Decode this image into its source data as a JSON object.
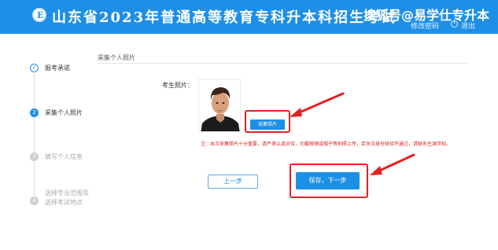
{
  "header": {
    "logo_char": "E",
    "title": "山东省2023年普通高等教育专科升本科招生考试",
    "watermark": "搜狐号@易学仕专升本",
    "change_password": "修改密码",
    "logout": "退出",
    "background_color": "#1e8fe6"
  },
  "steps": [
    {
      "number": "✓",
      "label": "报考承诺",
      "state": "done"
    },
    {
      "number": "2",
      "label": "采集个人照片",
      "state": "active"
    },
    {
      "number": "3",
      "label": "填写个人信息",
      "state": "todo"
    },
    {
      "number": "4",
      "label": "选择专业范围及选择考试地点",
      "state": "todo"
    }
  ],
  "main": {
    "section_title": "采集个人照片",
    "photo_label": "考生照片：",
    "capture_button": "采集照片",
    "note": "注：本次采集照片十分重要，请严肃认真对待，勿戴眼镜或帽子等拍照上传，若多次身份核验不通过，请联系生源学校。",
    "prev_button": "上一步",
    "next_button": "保存，下一步"
  },
  "colors": {
    "accent": "#1e8fe6",
    "highlight": "#e52020"
  }
}
